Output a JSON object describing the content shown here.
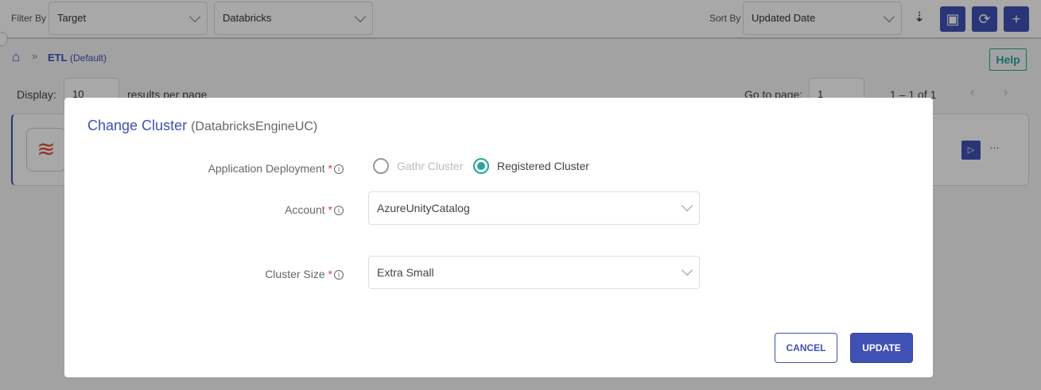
{
  "toolbar": {
    "filter_label": "Filter By",
    "filter_target": "Target",
    "filter_engine": "Databricks",
    "sort_label": "Sort By",
    "sort_value": "Updated Date"
  },
  "breadcrumb": {
    "current": "ETL",
    "suffix": "(Default)"
  },
  "help_label": "Help",
  "pagination": {
    "display_label": "Display:",
    "per_page": "10",
    "per_page_suffix": "results per page",
    "goto_label": "Go to page:",
    "page": "1",
    "range": "1 – 1 of 1"
  },
  "modal": {
    "title": "Change Cluster",
    "subtitle": "(DatabricksEngineUC)",
    "deployment_label": "Application Deployment",
    "option_gathr": "Gathr Cluster",
    "option_registered": "Registered Cluster",
    "selected": "Registered Cluster",
    "account_label": "Account",
    "account_value": "AzureUnityCatalog",
    "size_label": "Cluster Size",
    "size_value": "Extra Small",
    "required_mark": "*",
    "cancel": "CANCEL",
    "update": "UPDATE"
  },
  "colors": {
    "primary": "#3f51b5",
    "accent": "#26a69a",
    "required": "#e53935"
  }
}
